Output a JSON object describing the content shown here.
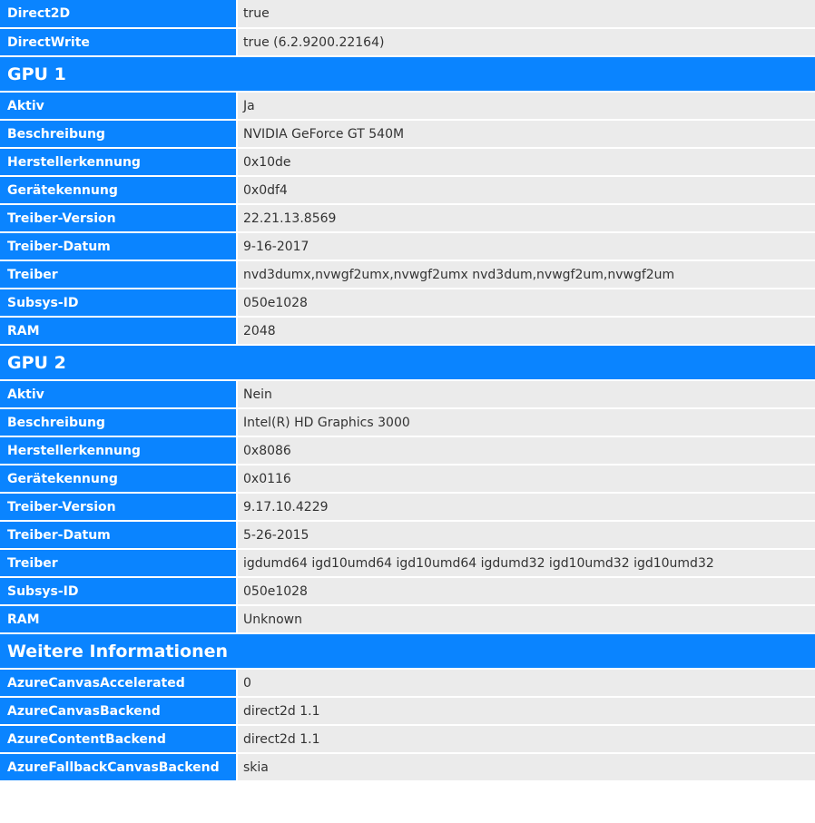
{
  "top_rows": [
    {
      "key": "Direct2D",
      "value": "true"
    },
    {
      "key": "DirectWrite",
      "value": "true (6.2.9200.22164)"
    }
  ],
  "gpu1": {
    "title": "GPU 1",
    "rows": [
      {
        "key": "Aktiv",
        "value": "Ja"
      },
      {
        "key": "Beschreibung",
        "value": "NVIDIA GeForce GT 540M"
      },
      {
        "key": "Herstellerkennung",
        "value": "0x10de"
      },
      {
        "key": "Gerätekennung",
        "value": "0x0df4"
      },
      {
        "key": "Treiber-Version",
        "value": "22.21.13.8569"
      },
      {
        "key": "Treiber-Datum",
        "value": "9-16-2017"
      },
      {
        "key": "Treiber",
        "value": "nvd3dumx,nvwgf2umx,nvwgf2umx nvd3dum,nvwgf2um,nvwgf2um"
      },
      {
        "key": "Subsys-ID",
        "value": "050e1028"
      },
      {
        "key": "RAM",
        "value": "2048"
      }
    ]
  },
  "gpu2": {
    "title": "GPU 2",
    "rows": [
      {
        "key": "Aktiv",
        "value": "Nein"
      },
      {
        "key": "Beschreibung",
        "value": "Intel(R) HD Graphics 3000"
      },
      {
        "key": "Herstellerkennung",
        "value": "0x8086"
      },
      {
        "key": "Gerätekennung",
        "value": "0x0116"
      },
      {
        "key": "Treiber-Version",
        "value": "9.17.10.4229"
      },
      {
        "key": "Treiber-Datum",
        "value": "5-26-2015"
      },
      {
        "key": "Treiber",
        "value": "igdumd64 igd10umd64 igd10umd64 igdumd32 igd10umd32 igd10umd32"
      },
      {
        "key": "Subsys-ID",
        "value": "050e1028"
      },
      {
        "key": "RAM",
        "value": "Unknown"
      }
    ]
  },
  "more_info": {
    "title": "Weitere Informationen",
    "rows": [
      {
        "key": "AzureCanvasAccelerated",
        "value": "0"
      },
      {
        "key": "AzureCanvasBackend",
        "value": "direct2d 1.1"
      },
      {
        "key": "AzureContentBackend",
        "value": "direct2d 1.1"
      },
      {
        "key": "AzureFallbackCanvasBackend",
        "value": "skia"
      }
    ]
  }
}
